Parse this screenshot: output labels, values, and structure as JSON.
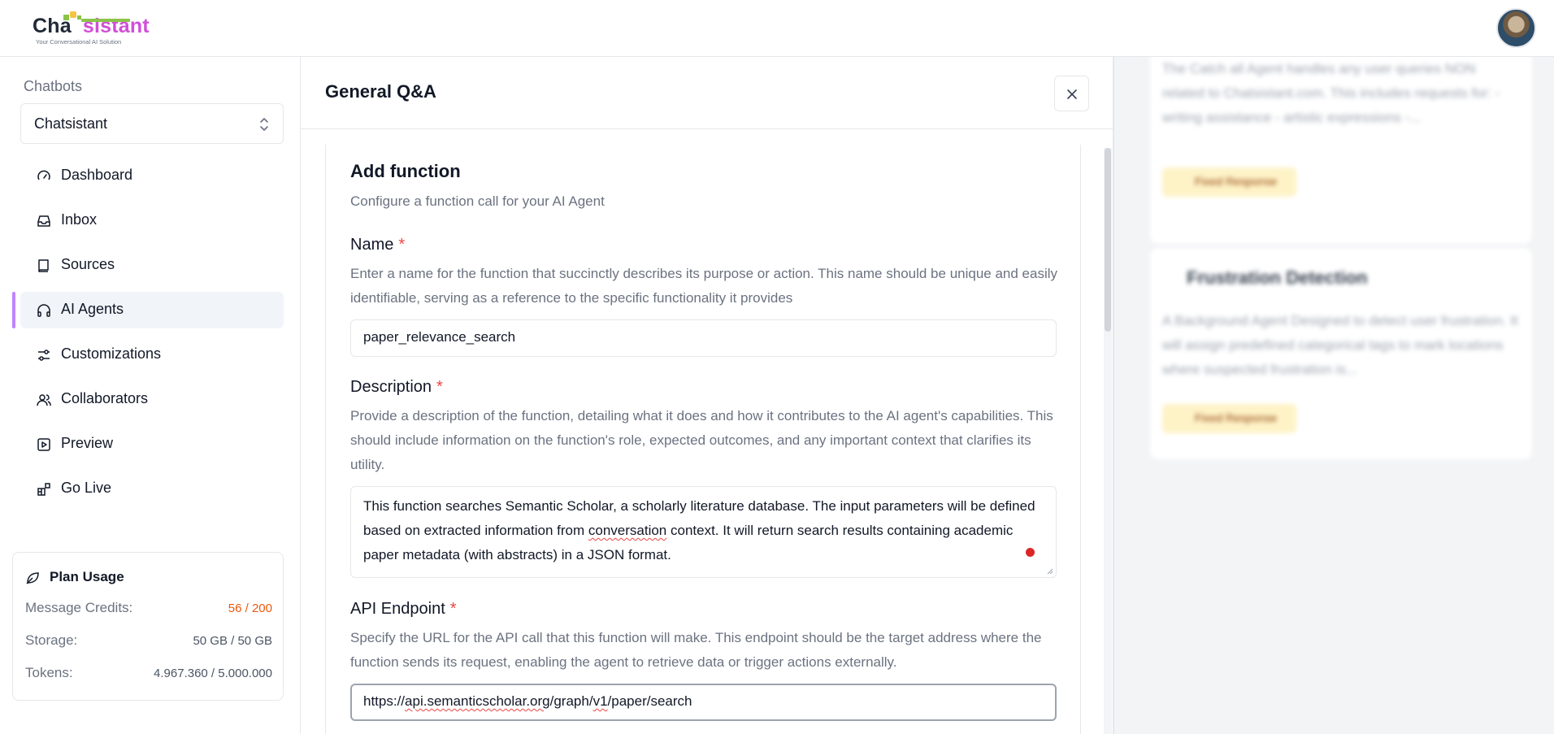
{
  "header": {
    "logo_text_a": "Cha",
    "logo_text_b": "sistant",
    "logo_tagline": "Your Conversational AI Solution"
  },
  "sidebar": {
    "heading": "Chatbots",
    "selected_bot": "Chatsistant",
    "items": [
      {
        "label": "Dashboard",
        "icon": "gauge-icon"
      },
      {
        "label": "Inbox",
        "icon": "inbox-icon"
      },
      {
        "label": "Sources",
        "icon": "book-icon"
      },
      {
        "label": "AI Agents",
        "icon": "headphones-icon",
        "active": true
      },
      {
        "label": "Customizations",
        "icon": "sliders-icon"
      },
      {
        "label": "Collaborators",
        "icon": "users-icon"
      },
      {
        "label": "Preview",
        "icon": "play-square-icon"
      },
      {
        "label": "Go Live",
        "icon": "blocks-icon"
      }
    ],
    "plan": {
      "title": "Plan Usage",
      "rows": [
        {
          "key": "Message Credits:",
          "value": "56 / 200"
        },
        {
          "key": "Storage:",
          "value": "50 GB / 50 GB"
        },
        {
          "key": "Tokens:",
          "value": "4.967.360 / 5.000.000"
        }
      ]
    }
  },
  "panel": {
    "title": "General Q&A",
    "form": {
      "title": "Add function",
      "subtitle": "Configure a function call for your AI Agent",
      "name_label": "Name",
      "name_help": "Enter a name for the function that succinctly describes its purpose or action. This name should be unique and easily identifiable, serving as a reference to the specific functionality it provides",
      "name_value": "paper_relevance_search",
      "desc_label": "Description",
      "desc_help": "Provide a description of the function, detailing what it does and how it contributes to the AI agent's capabilities. This should include information on the function's role, expected outcomes, and any important context that clarifies its utility.",
      "desc_value_a": "This function searches Semantic Scholar, a scholarly literature database. The input parameters will be defined based on extracted information from ",
      "desc_value_b": "conversation",
      "desc_value_c": " context. It will return search results containing academic paper metadata (with abstracts) in a JSON format.",
      "api_label": "API Endpoint",
      "api_help": "Specify the URL for the API call that this function will make. This endpoint should be the target address where the function sends its request, enabling the agent to retrieve data or trigger actions externally.",
      "api_value_a": "https://",
      "api_value_b": "api.semanticscholar.org",
      "api_value_c": "/graph/",
      "api_value_d": "v1",
      "api_value_e": "/paper/search",
      "required_mark": "*"
    }
  },
  "background": {
    "card1_text": "The Catch all Agent handles any user queries NON related to Chatsistant.com. This includes requests for: - writing assistance - artistic expressions -...",
    "card1_pill": "Fixed Response",
    "card2_title": "Frustration Detection",
    "card2_text": "A Background Agent Designed to detect user frustration. It will assign predefined categorical tags to mark locations where suspected frustration is...",
    "card2_pill": "Fixed Response"
  },
  "colors": {
    "accent": "#c084fc",
    "required": "#ef4444",
    "warning": "#ea580c"
  }
}
